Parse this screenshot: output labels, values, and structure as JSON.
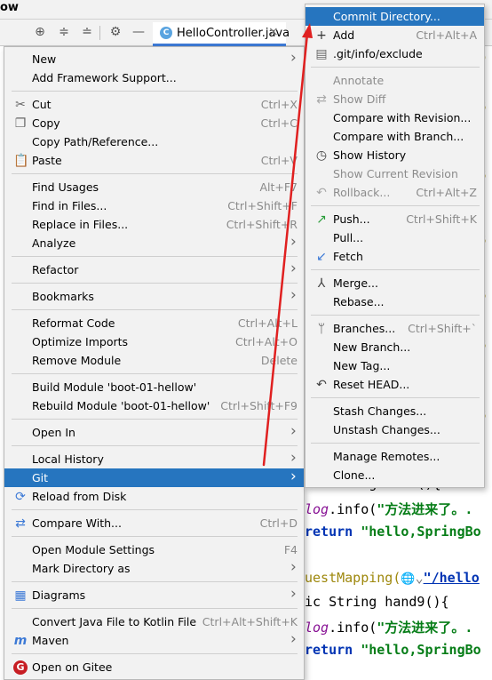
{
  "window_title": "ow",
  "editor": {
    "tab_label": "HelloController.java",
    "tab_icon": "C",
    "code_lines": [
      {
        "kind": "plain",
        "pre": "ic String hand",
        "post": "(){"
      },
      {
        "kind": "log",
        "obj": "log",
        "call": ".info(",
        "str": "\"方法进来了。.",
        "end": ""
      },
      {
        "kind": "ret",
        "kw": "return",
        "str": "\"hello,SpringBo"
      },
      {
        "kind": "ann",
        "ann": "uestMapping(",
        "globe": "🌐",
        "chev": "⌄",
        "link": "\"/hello"
      },
      {
        "kind": "method",
        "pre": "ic String hand9(){"
      },
      {
        "kind": "log",
        "obj": "log",
        "call": ".info(",
        "str": "\"方法进来了。.",
        "end": ""
      },
      {
        "kind": "ret",
        "kw": "return",
        "str": "\"hello,SpringBo"
      }
    ],
    "right_strip_chars": [
      "o",
      "B",
      "B",
      "B",
      "B",
      "B",
      "B"
    ]
  },
  "context_menu": {
    "items": [
      {
        "label": "New",
        "submenu": true
      },
      {
        "label": "Add Framework Support..."
      },
      {
        "sep": true
      },
      {
        "label": "Cut",
        "u": "t",
        "shortcut": "Ctrl+X",
        "icon": "scissors-icon"
      },
      {
        "label": "Copy",
        "shortcut": "Ctrl+C",
        "icon": "copy-icon"
      },
      {
        "label": "Copy Path/Reference..."
      },
      {
        "label": "Paste",
        "shortcut": "Ctrl+V",
        "icon": "paste-icon"
      },
      {
        "sep": true
      },
      {
        "label": "Find Usages",
        "shortcut": "Alt+F7"
      },
      {
        "label": "Find in Files...",
        "shortcut": "Ctrl+Shift+F"
      },
      {
        "label": "Replace in Files...",
        "shortcut": "Ctrl+Shift+R"
      },
      {
        "label": "Analyze",
        "submenu": true
      },
      {
        "sep": true
      },
      {
        "label": "Refactor",
        "submenu": true
      },
      {
        "sep": true
      },
      {
        "label": "Bookmarks",
        "submenu": true
      },
      {
        "sep": true
      },
      {
        "label": "Reformat Code",
        "shortcut": "Ctrl+Alt+L"
      },
      {
        "label": "Optimize Imports",
        "shortcut": "Ctrl+Alt+O"
      },
      {
        "label": "Remove Module",
        "shortcut": "Delete"
      },
      {
        "sep": true
      },
      {
        "label": "Build Module 'boot-01-hellow'"
      },
      {
        "label": "Rebuild Module 'boot-01-hellow'",
        "shortcut": "Ctrl+Shift+F9"
      },
      {
        "sep": true
      },
      {
        "label": "Open In",
        "submenu": true
      },
      {
        "sep": true
      },
      {
        "label": "Local History",
        "submenu": true
      },
      {
        "label": "Git",
        "submenu": true,
        "selected": true
      },
      {
        "label": "Reload from Disk",
        "icon": "reload-icon"
      },
      {
        "sep": true
      },
      {
        "label": "Compare With...",
        "shortcut": "Ctrl+D",
        "icon": "compare-icon"
      },
      {
        "sep": true
      },
      {
        "label": "Open Module Settings",
        "shortcut": "F4"
      },
      {
        "label": "Mark Directory as",
        "submenu": true
      },
      {
        "sep": true
      },
      {
        "label": "Diagrams",
        "submenu": true,
        "icon": "diagram-icon"
      },
      {
        "sep": true
      },
      {
        "label": "Convert Java File to Kotlin File",
        "shortcut": "Ctrl+Alt+Shift+K"
      },
      {
        "label": "Maven",
        "submenu": true,
        "icon": "maven-icon"
      },
      {
        "sep": true
      },
      {
        "label": "Open on Gitee",
        "icon": "gitee-icon"
      }
    ]
  },
  "git_menu": {
    "items": [
      {
        "label": "Commit Directory...",
        "selected": true
      },
      {
        "label": "Add",
        "shortcut": "Ctrl+Alt+A",
        "icon": "plus-icon"
      },
      {
        "label": ".git/info/exclude",
        "icon": "git-file-icon"
      },
      {
        "sep": true
      },
      {
        "label": "Annotate",
        "disabled": true
      },
      {
        "label": "Show Diff",
        "disabled": true,
        "icon": "diff-icon"
      },
      {
        "label": "Compare with Revision..."
      },
      {
        "label": "Compare with Branch..."
      },
      {
        "label": "Show History",
        "icon": "history-icon"
      },
      {
        "label": "Show Current Revision",
        "disabled": true
      },
      {
        "label": "Rollback...",
        "shortcut": "Ctrl+Alt+Z",
        "disabled": true,
        "icon": "rollback-icon"
      },
      {
        "sep": true
      },
      {
        "label": "Push...",
        "shortcut": "Ctrl+Shift+K",
        "icon": "push-icon"
      },
      {
        "label": "Pull..."
      },
      {
        "label": "Fetch",
        "icon": "fetch-icon"
      },
      {
        "sep": true
      },
      {
        "label": "Merge...",
        "icon": "merge-icon"
      },
      {
        "label": "Rebase..."
      },
      {
        "sep": true
      },
      {
        "label": "Branches...",
        "shortcut": "Ctrl+Shift+`",
        "icon": "branch-icon"
      },
      {
        "label": "New Branch..."
      },
      {
        "label": "New Tag..."
      },
      {
        "label": "Reset HEAD...",
        "icon": "reset-icon"
      },
      {
        "sep": true
      },
      {
        "label": "Stash Changes..."
      },
      {
        "label": "Unstash Changes..."
      },
      {
        "sep": true
      },
      {
        "label": "Manage Remotes..."
      },
      {
        "label": "Clone..."
      }
    ]
  },
  "colors": {
    "menu_bg": "#f2f2f2",
    "selection": "#2675bf",
    "arrow": "#e02020"
  }
}
